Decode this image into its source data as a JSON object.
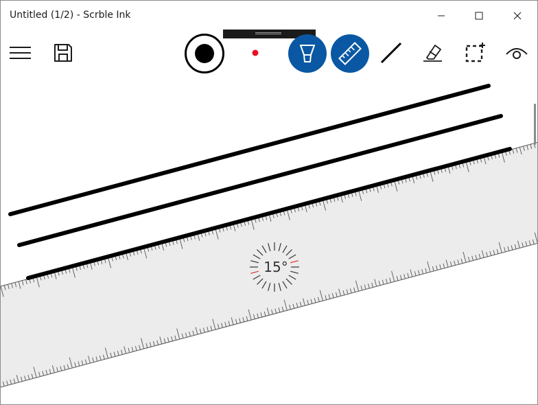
{
  "window": {
    "title": "Untitled (1/2) - Scrble Ink"
  },
  "window_controls": [
    {
      "name": "minimize",
      "icon": "minimize-icon"
    },
    {
      "name": "maximize",
      "icon": "maximize-icon"
    },
    {
      "name": "close",
      "icon": "close-icon"
    }
  ],
  "toolbar": {
    "left_tools": [
      {
        "name": "menu",
        "icon": "hamburger-menu-icon"
      },
      {
        "name": "save",
        "icon": "floppy-disk-icon"
      }
    ],
    "center_tools": [
      {
        "name": "pen-size",
        "icon": "pen-size-circle-icon"
      },
      {
        "name": "pen-color",
        "icon": "color-dot-icon",
        "color": "#e81123"
      },
      {
        "name": "highlighter",
        "icon": "highlighter-icon",
        "active": true
      },
      {
        "name": "ruler",
        "icon": "ruler-icon",
        "active": true
      },
      {
        "name": "line",
        "icon": "line-tool-icon"
      },
      {
        "name": "eraser",
        "icon": "eraser-icon"
      },
      {
        "name": "selection",
        "icon": "lasso-select-icon"
      },
      {
        "name": "view",
        "icon": "eye-icon"
      }
    ],
    "accent_color": "#0a58a3"
  },
  "ruler": {
    "angle_label": "15°",
    "angle_degrees": 15,
    "fill_color": "#ececec"
  },
  "ink_color": "#000000"
}
